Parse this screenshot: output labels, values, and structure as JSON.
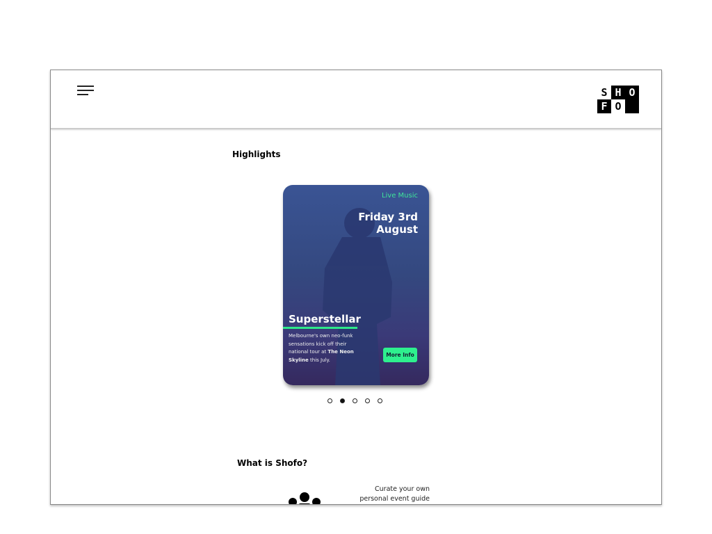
{
  "header": {
    "menu_icon": "hamburger-menu-icon",
    "logo": [
      "S",
      "H",
      "O",
      "F",
      "O",
      ""
    ]
  },
  "highlights": {
    "heading": "Highlights",
    "card": {
      "category": "Live Music",
      "date": "Friday 3rd August",
      "title": "Superstellar",
      "desc_1": "Melbourne's own neo-funk sensations kick off their national tour at ",
      "desc_bold_1": "The Neon Skyline",
      "desc_2": " this July.",
      "button": "More Info"
    },
    "carousel": {
      "total": 5,
      "active_index": 1
    }
  },
  "about": {
    "heading": "What is Shofo?",
    "feature_text": "Curate your own personal event guide",
    "feature_icon": "people-group-icon"
  },
  "colors": {
    "accent": "#2ee88a",
    "card_top": "#3a5494",
    "card_bottom": "#35295e"
  }
}
